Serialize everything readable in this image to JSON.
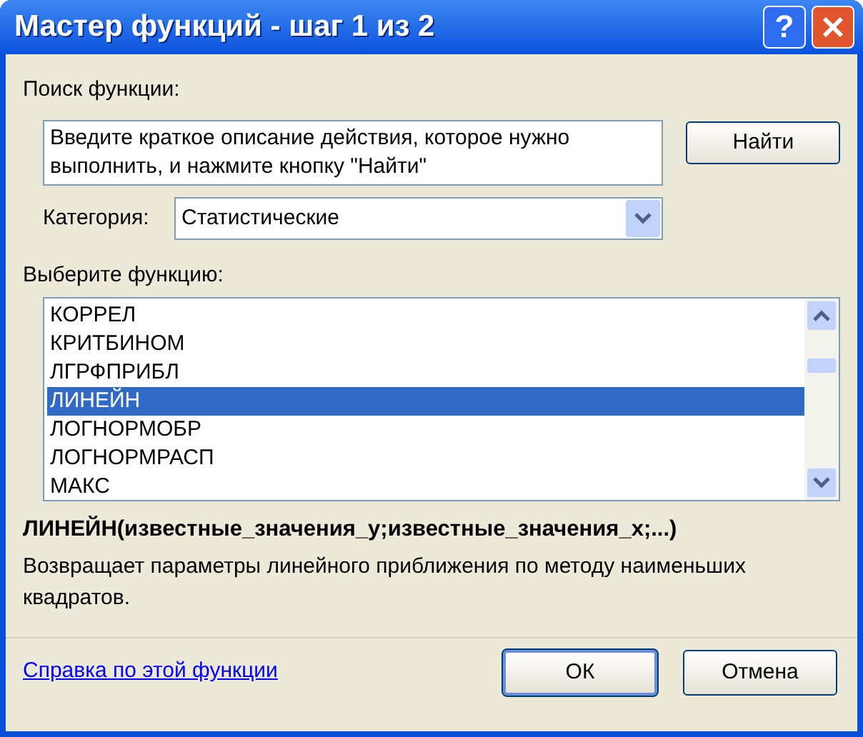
{
  "window": {
    "title": "Мастер функций - шаг 1 из 2",
    "help_button": "?"
  },
  "search": {
    "label": "Поиск функции:",
    "value": "Введите краткое описание действия, которое нужно выполнить, и нажмите кнопку \"Найти\"",
    "button": "Найти"
  },
  "category": {
    "label": "Категория:",
    "value": "Статистические"
  },
  "function_list": {
    "label": "Выберите функцию:",
    "items": [
      {
        "label": "КОРРЕЛ",
        "selected": false
      },
      {
        "label": "КРИТБИНОМ",
        "selected": false
      },
      {
        "label": "ЛГРФПРИБЛ",
        "selected": false
      },
      {
        "label": "ЛИНЕЙН",
        "selected": true
      },
      {
        "label": "ЛОГНОРМОБР",
        "selected": false
      },
      {
        "label": "ЛОГНОРМРАСП",
        "selected": false
      },
      {
        "label": "МАКС",
        "selected": false
      }
    ]
  },
  "signature": "ЛИНЕЙН(известные_значения_y;известные_значения_x;...)",
  "description": "Возвращает параметры линейного приближения по методу наименьших квадратов.",
  "help_link": "Справка по этой функции",
  "buttons": [
    {
      "label": "ОК",
      "default": true
    },
    {
      "label": "Отмена",
      "default": false
    }
  ]
}
